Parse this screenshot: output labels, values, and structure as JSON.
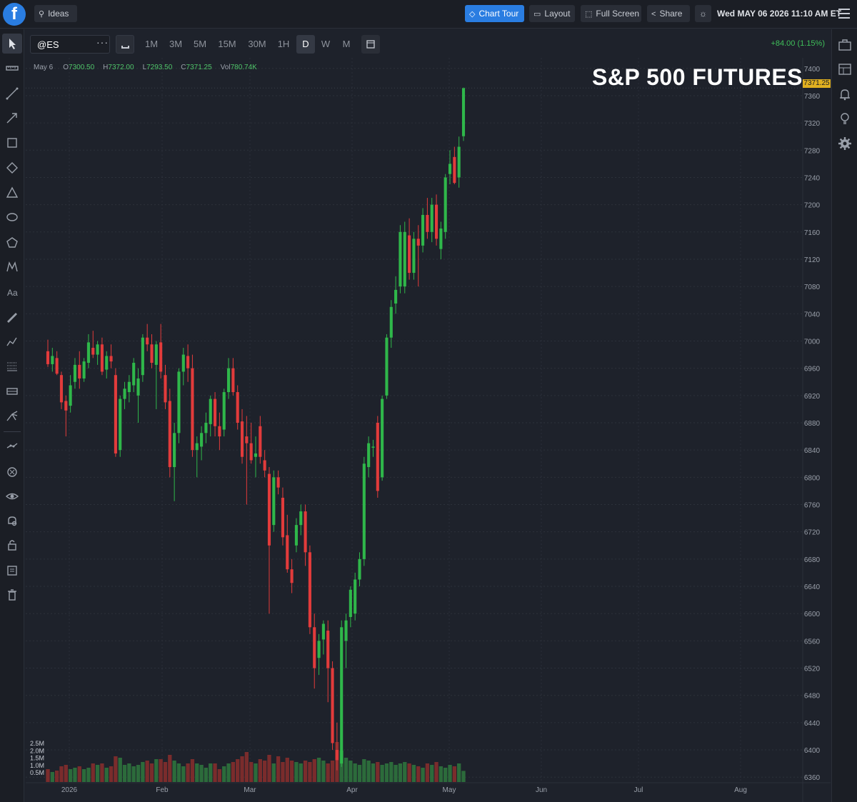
{
  "topbar": {
    "logo_letter": "f",
    "ideas_label": "Ideas",
    "chart_tour_label": "Chart Tour",
    "layout_label": "Layout",
    "fullscreen_label": "Full Screen",
    "share_label": "Share",
    "datetime": "Wed MAY 06 2026 11:10 AM ET"
  },
  "toolbar": {
    "symbol": "@ES",
    "more": "···",
    "timeframes": [
      "1M",
      "3M",
      "5M",
      "15M",
      "30M",
      "1H",
      "D",
      "W",
      "M"
    ],
    "active_timeframe": "D",
    "change": "+84.00 (1.15%)"
  },
  "ohlc": {
    "date": "May 6",
    "open_key": "O",
    "open": "7300.50",
    "high_key": "H",
    "high": "7372.00",
    "low_key": "L",
    "low": "7293.50",
    "close_key": "C",
    "close": "7371.25",
    "vol_key": "Vol",
    "vol": "780.74K"
  },
  "chart_data": {
    "type": "candlestick",
    "title": "S&P 500 FUTURES",
    "last_price": "7371.25",
    "y_ticks": [
      7400,
      7360,
      7320,
      7280,
      7240,
      7200,
      7160,
      7120,
      7080,
      7040,
      7000,
      6960,
      6920,
      6880,
      6840,
      6800,
      6760,
      6720,
      6680,
      6640,
      6600,
      6560,
      6520,
      6480,
      6440,
      6400,
      6360
    ],
    "ylim": [
      6355,
      7405
    ],
    "x_labels": [
      "2026",
      "Feb",
      "Mar",
      "Apr",
      "May",
      "Jun",
      "Jul",
      "Aug"
    ],
    "volume_ticks": [
      "2.5M",
      "2.0M",
      "1.5M",
      "1.0M",
      "0.5M"
    ],
    "candles": [
      [
        6985,
        7002,
        6962,
        6966,
        0.9
      ],
      [
        6966,
        6990,
        6955,
        6978,
        0.7
      ],
      [
        6975,
        6985,
        6950,
        6952,
        0.8
      ],
      [
        6950,
        6955,
        6900,
        6910,
        1.1
      ],
      [
        6912,
        6920,
        6860,
        6898,
        1.2
      ],
      [
        6905,
        6950,
        6895,
        6935,
        0.9
      ],
      [
        6940,
        6975,
        6930,
        6965,
        1.0
      ],
      [
        6965,
        6985,
        6930,
        6945,
        1.1
      ],
      [
        6945,
        6975,
        6940,
        6970,
        0.9
      ],
      [
        6968,
        7010,
        6960,
        6998,
        1.0
      ],
      [
        6990,
        7015,
        6975,
        6980,
        1.3
      ],
      [
        6980,
        7000,
        6965,
        6995,
        1.2
      ],
      [
        6995,
        7005,
        6950,
        6955,
        1.3
      ],
      [
        6958,
        6985,
        6945,
        6978,
        1.0
      ],
      [
        6978,
        6995,
        6960,
        6970,
        1.1
      ],
      [
        6950,
        6960,
        6830,
        6835,
        1.8
      ],
      [
        6840,
        6920,
        6830,
        6915,
        1.7
      ],
      [
        6915,
        6940,
        6900,
        6930,
        1.2
      ],
      [
        6925,
        6950,
        6910,
        6940,
        1.3
      ],
      [
        6935,
        6975,
        6925,
        6968,
        1.1
      ],
      [
        6920,
        6960,
        6880,
        6945,
        1.2
      ],
      [
        6950,
        7010,
        6940,
        7005,
        1.4
      ],
      [
        7005,
        7025,
        6985,
        6995,
        1.5
      ],
      [
        6995,
        7010,
        6960,
        6968,
        1.3
      ],
      [
        6965,
        7000,
        6900,
        6995,
        1.6
      ],
      [
        6998,
        7025,
        6945,
        6955,
        1.6
      ],
      [
        6950,
        6965,
        6900,
        6910,
        1.4
      ],
      [
        6912,
        6930,
        6800,
        6815,
        1.9
      ],
      [
        6815,
        6880,
        6765,
        6865,
        1.5
      ],
      [
        6865,
        6960,
        6850,
        6955,
        1.3
      ],
      [
        6955,
        6990,
        6935,
        6980,
        1.1
      ],
      [
        6978,
        6995,
        6940,
        6960,
        1.3
      ],
      [
        6960,
        6980,
        6830,
        6840,
        1.6
      ],
      [
        6840,
        6860,
        6800,
        6850,
        1.3
      ],
      [
        6845,
        6875,
        6825,
        6865,
        1.2
      ],
      [
        6865,
        6895,
        6850,
        6880,
        1.0
      ],
      [
        6878,
        6920,
        6860,
        6915,
        1.3
      ],
      [
        6915,
        6925,
        6860,
        6875,
        1.3
      ],
      [
        6875,
        6895,
        6840,
        6860,
        0.9
      ],
      [
        6870,
        6930,
        6860,
        6925,
        1.1
      ],
      [
        6925,
        6975,
        6915,
        6960,
        1.3
      ],
      [
        6960,
        6975,
        6920,
        6925,
        1.4
      ],
      [
        6925,
        6935,
        6870,
        6880,
        1.6
      ],
      [
        6882,
        6900,
        6820,
        6830,
        1.8
      ],
      [
        6860,
        6890,
        6760,
        6850,
        2.1
      ],
      [
        6850,
        6880,
        6820,
        6825,
        1.4
      ],
      [
        6830,
        6860,
        6800,
        6835,
        1.3
      ],
      [
        6875,
        6890,
        6820,
        6830,
        1.6
      ],
      [
        6825,
        6840,
        6800,
        6810,
        1.5
      ],
      [
        6805,
        6815,
        6600,
        6700,
        1.9
      ],
      [
        6730,
        6810,
        6720,
        6800,
        1.3
      ],
      [
        6800,
        6810,
        6775,
        6785,
        1.8
      ],
      [
        6770,
        6785,
        6700,
        6712,
        1.4
      ],
      [
        6715,
        6745,
        6660,
        6665,
        1.7
      ],
      [
        6665,
        6680,
        6630,
        6645,
        1.5
      ],
      [
        6700,
        6740,
        6690,
        6730,
        1.4
      ],
      [
        6730,
        6760,
        6715,
        6750,
        1.3
      ],
      [
        6750,
        6760,
        6670,
        6690,
        1.5
      ],
      [
        6690,
        6700,
        6570,
        6580,
        1.4
      ],
      [
        6580,
        6600,
        6490,
        6520,
        1.6
      ],
      [
        6535,
        6570,
        6510,
        6560,
        1.7
      ],
      [
        6562,
        6590,
        6540,
        6585,
        1.5
      ],
      [
        6575,
        6590,
        6470,
        6520,
        1.3
      ],
      [
        6520,
        6530,
        6400,
        6410,
        1.5
      ],
      [
        6400,
        6440,
        6370,
        6385,
        2.8
      ],
      [
        6380,
        6590,
        6375,
        6580,
        2.2
      ],
      [
        6560,
        6600,
        6520,
        6590,
        1.7
      ],
      [
        6595,
        6640,
        6580,
        6635,
        1.5
      ],
      [
        6600,
        6660,
        6590,
        6650,
        1.3
      ],
      [
        6650,
        6690,
        6640,
        6680,
        1.2
      ],
      [
        6680,
        6830,
        6670,
        6820,
        1.6
      ],
      [
        6815,
        6860,
        6800,
        6850,
        1.5
      ],
      [
        6845,
        6855,
        6830,
        6845,
        1.3
      ],
      [
        6880,
        6890,
        6770,
        6780,
        1.4
      ],
      [
        6800,
        6920,
        6795,
        6915,
        1.2
      ],
      [
        6920,
        7010,
        6915,
        7005,
        1.3
      ],
      [
        7005,
        7060,
        6990,
        7050,
        1.4
      ],
      [
        7055,
        7095,
        7040,
        7075,
        1.2
      ],
      [
        7080,
        7170,
        7070,
        7160,
        1.3
      ],
      [
        7080,
        7175,
        7070,
        7160,
        1.4
      ],
      [
        7155,
        7180,
        7090,
        7100,
        1.3
      ],
      [
        7100,
        7160,
        7090,
        7150,
        1.2
      ],
      [
        7150,
        7170,
        7080,
        7140,
        1.1
      ],
      [
        7140,
        7195,
        7130,
        7185,
        1.0
      ],
      [
        7185,
        7210,
        7150,
        7160,
        1.3
      ],
      [
        7160,
        7210,
        7145,
        7200,
        1.2
      ],
      [
        7200,
        7215,
        7140,
        7150,
        1.4
      ],
      [
        7135,
        7175,
        7120,
        7165,
        1.1
      ],
      [
        7160,
        7245,
        7150,
        7240,
        1.0
      ],
      [
        7245,
        7280,
        7230,
        7260,
        1.2
      ],
      [
        7270,
        7285,
        7230,
        7232,
        1.1
      ],
      [
        7240,
        7300,
        7225,
        7285,
        1.3
      ],
      [
        7300.5,
        7372,
        7293.5,
        7371.25,
        0.78
      ]
    ]
  },
  "colors": {
    "up": "#2fb74a",
    "down": "#e23b3b",
    "accent": "#2a7de1",
    "last_price": "#e0b020"
  },
  "icons": {
    "left": [
      "cursor-icon",
      "ruler-icon",
      "trendline-icon",
      "arrow-icon",
      "rectangle-icon",
      "rotated-rectangle-icon",
      "triangle-icon",
      "ellipse-icon",
      "polygon-icon",
      "pattern-icon",
      "text-icon",
      "brush-icon",
      "path-icon",
      "fib-retracement-icon",
      "price-range-icon",
      "pitchfork-icon",
      "measure-icon",
      "hide-drawings-icon",
      "show-icon",
      "alert-eye-icon",
      "lock-icon",
      "notes-icon",
      "trash-icon"
    ],
    "right": [
      "briefcase-icon",
      "layout-grid-icon",
      "bell-icon",
      "lightbulb-icon",
      "settings-icon"
    ]
  }
}
